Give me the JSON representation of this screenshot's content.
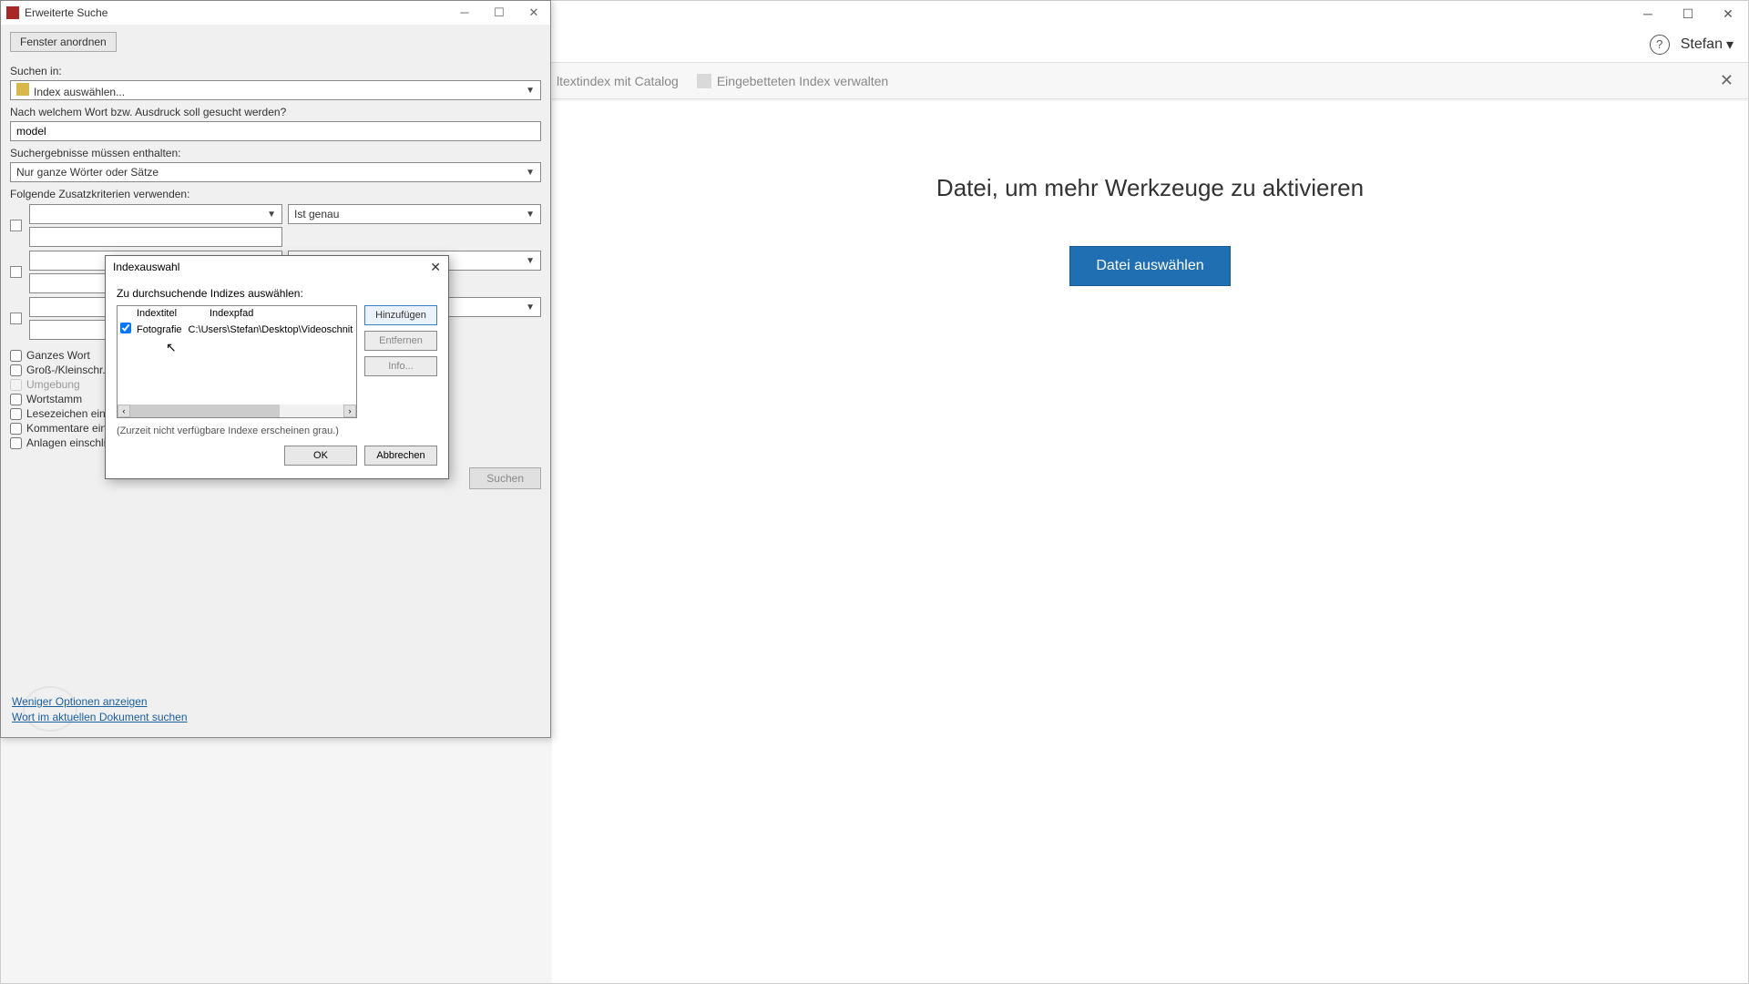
{
  "app": {
    "user": "Stefan",
    "subbar_item1": "ltextindex mit Catalog",
    "subbar_item2": "Eingebetteten Index verwalten"
  },
  "main": {
    "headline": "Datei, um mehr Werkzeuge zu aktivieren",
    "button": "Datei auswählen"
  },
  "search": {
    "title": "Erweiterte Suche",
    "arrange_btn": "Fenster anordnen",
    "search_in_label": "Suchen in:",
    "search_in_value": "Index auswählen...",
    "word_label": "Nach welchem Wort bzw. Ausdruck soll gesucht werden?",
    "word_value": "model",
    "results_label": "Suchergebnisse müssen enthalten:",
    "results_value": "Nur ganze Wörter oder Sätze",
    "criteria_label": "Folgende Zusatzkriterien verwenden:",
    "criteria_op": "Ist genau",
    "checks": {
      "whole_word": "Ganzes Wort",
      "case": "Groß-/Kleinschr.",
      "proximity": "Umgebung",
      "stem": "Wortstamm",
      "bookmarks": "Lesezeichen einschließen",
      "comments": "Kommentare einschließen",
      "attachments": "Anlagen einschließen"
    },
    "search_btn": "Suchen",
    "less_options": "Weniger Optionen anzeigen",
    "search_doc": "Wort im aktuellen Dokument suchen"
  },
  "index_modal": {
    "title": "Indexauswahl",
    "label": "Zu durchsuchende Indizes auswählen:",
    "col_title": "Indextitel",
    "col_path": "Indexpfad",
    "row_title": "Fotografie",
    "row_path": "C:\\Users\\Stefan\\Desktop\\Videoschnit",
    "add": "Hinzufügen",
    "remove": "Entfernen",
    "info": "Info...",
    "note": "(Zurzeit nicht verfügbare Indexe erscheinen grau.)",
    "ok": "OK",
    "cancel": "Abbrechen"
  }
}
